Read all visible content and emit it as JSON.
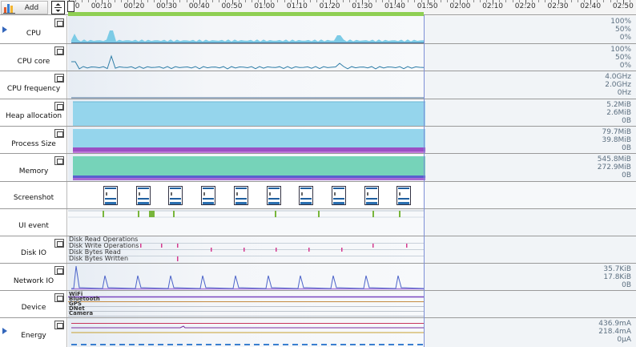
{
  "toolbar": {
    "add_label": "Add"
  },
  "ruler": {
    "ticks": [
      "00:00",
      "00:10",
      "00:20",
      "00:30",
      "00:40",
      "00:50",
      "01:00",
      "01:10",
      "01:20",
      "01:30",
      "01:40",
      "01:50",
      "02:00",
      "02:10",
      "02:20",
      "02:30",
      "02:40",
      "02:50"
    ]
  },
  "rows": {
    "cpu": {
      "label": "CPU",
      "scale": [
        "100%",
        "50%",
        "0%"
      ]
    },
    "cpu_core": {
      "label": "CPU core",
      "scale": [
        "100%",
        "50%",
        "0%"
      ]
    },
    "cpu_freq": {
      "label": "CPU frequency",
      "scale": [
        "4.0GHz",
        "2.0GHz",
        "0Hz"
      ]
    },
    "heap": {
      "label": "Heap allocation",
      "scale": [
        "5.2MiB",
        "2.6MiB",
        "0B"
      ]
    },
    "process": {
      "label": "Process Size",
      "scale": [
        "79.7MiB",
        "39.8MiB",
        "0B"
      ]
    },
    "memory": {
      "label": "Memory",
      "scale": [
        "545.8MiB",
        "272.9MiB",
        "0B"
      ]
    },
    "screenshot": {
      "label": "Screenshot"
    },
    "ui_event": {
      "label": "UI event"
    },
    "disk": {
      "label": "Disk IO",
      "series": [
        "Disk Read Operations",
        "Disk Write Operations",
        "Disk Bytes Read",
        "Disk Bytes Written"
      ]
    },
    "network": {
      "label": "Network IO",
      "scale": [
        "35.7KiB",
        "17.8KiB",
        "0B"
      ]
    },
    "device": {
      "label": "Device",
      "series": [
        "WiFi",
        "Bluetooth",
        "GPS",
        "DNet",
        "Camera"
      ]
    },
    "energy": {
      "label": "Energy",
      "scale": [
        "436.9mA",
        "218.4mA",
        "0µA"
      ]
    }
  },
  "colors": {
    "cpu": "#7ccbe6",
    "heap": "#95d5ec",
    "process_band": "#9b4fc4",
    "memory": "#76d3b9",
    "memory_band": "#5a5fd0",
    "ui_event": "#78b63c",
    "network": "#4b63c9",
    "energy": "#c7365c"
  }
}
